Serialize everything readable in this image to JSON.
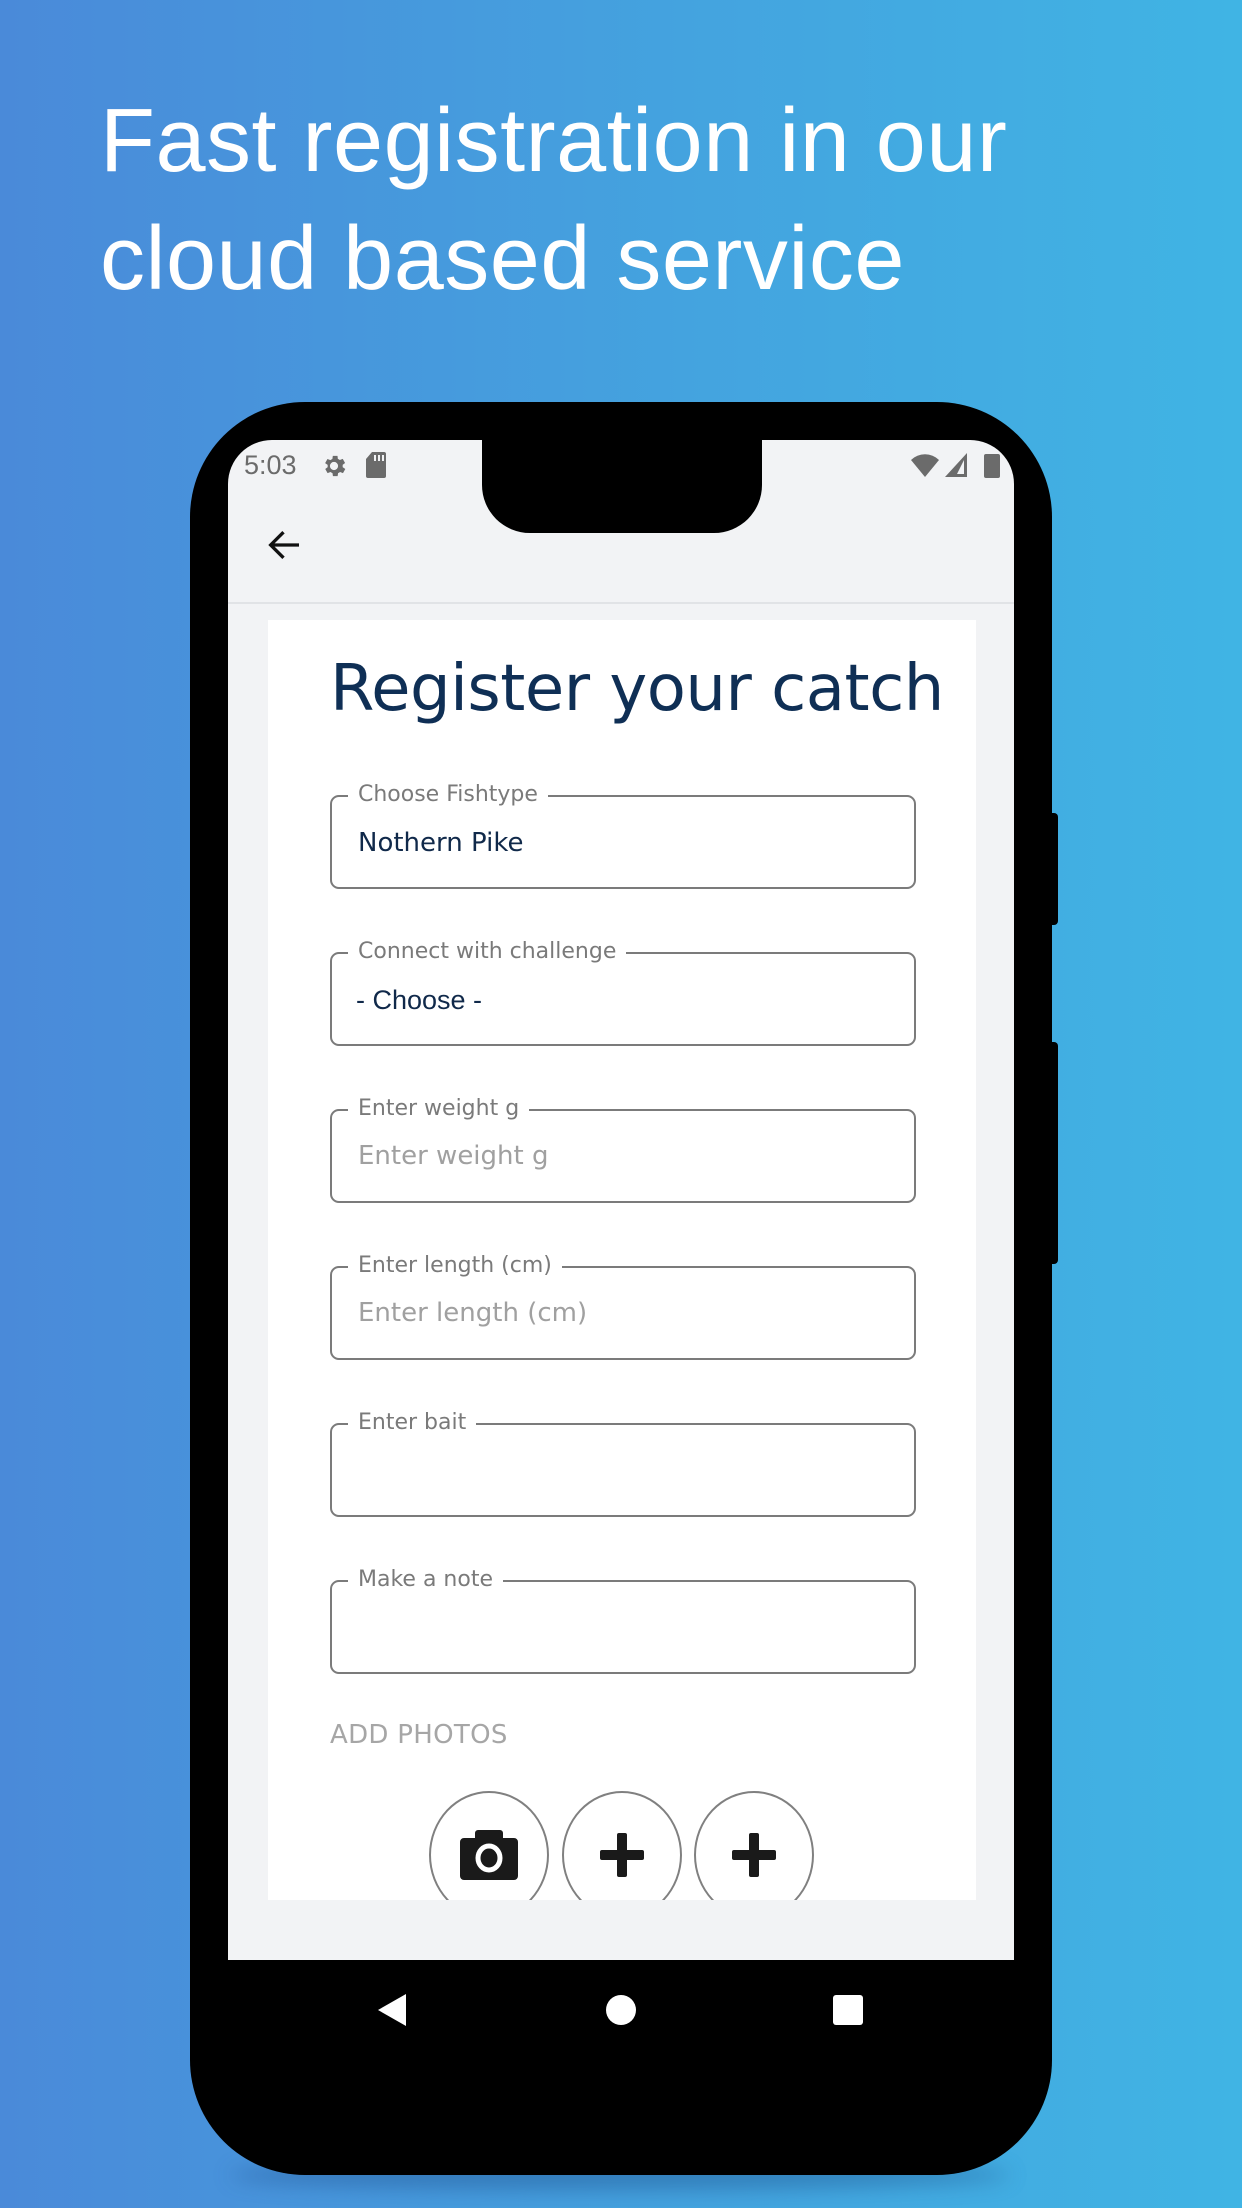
{
  "promo": {
    "headline_line1": "Fast registration in our",
    "headline_line2": "cloud based service"
  },
  "status_bar": {
    "time": "5:03",
    "left_icons": [
      "gear-icon",
      "sd-card-icon"
    ],
    "right_icons": [
      "wifi-icon",
      "cellular-signal-icon",
      "battery-icon"
    ]
  },
  "app_bar": {
    "back_icon": "arrow-left-icon"
  },
  "form": {
    "title": "Register your catch",
    "fields": [
      {
        "label": "Choose Fishtype",
        "value": "Nothern Pike",
        "placeholder": ""
      },
      {
        "label": "Connect with challenge",
        "value": "- Choose -",
        "placeholder": ""
      },
      {
        "label": "Enter weight g",
        "value": "",
        "placeholder": "Enter weight g"
      },
      {
        "label": "Enter length (cm)",
        "value": "",
        "placeholder": "Enter length (cm)"
      },
      {
        "label": "Enter bait",
        "value": "",
        "placeholder": ""
      },
      {
        "label": "Make a note",
        "value": "",
        "placeholder": ""
      }
    ],
    "add_photos_label": "ADD PHOTOS",
    "photo_buttons": [
      "camera-icon",
      "plus-icon",
      "plus-icon"
    ]
  },
  "nav_bar": {
    "buttons": [
      "back-triangle-icon",
      "home-circle-icon",
      "recents-square-icon"
    ]
  },
  "colors": {
    "title": "#0f2f55",
    "field_border": "#7b7b7b",
    "label": "#7a7a7a",
    "placeholder": "#a0a0a0",
    "background_gradient_start": "#4a8ad9",
    "background_gradient_end": "#40b4e4"
  }
}
